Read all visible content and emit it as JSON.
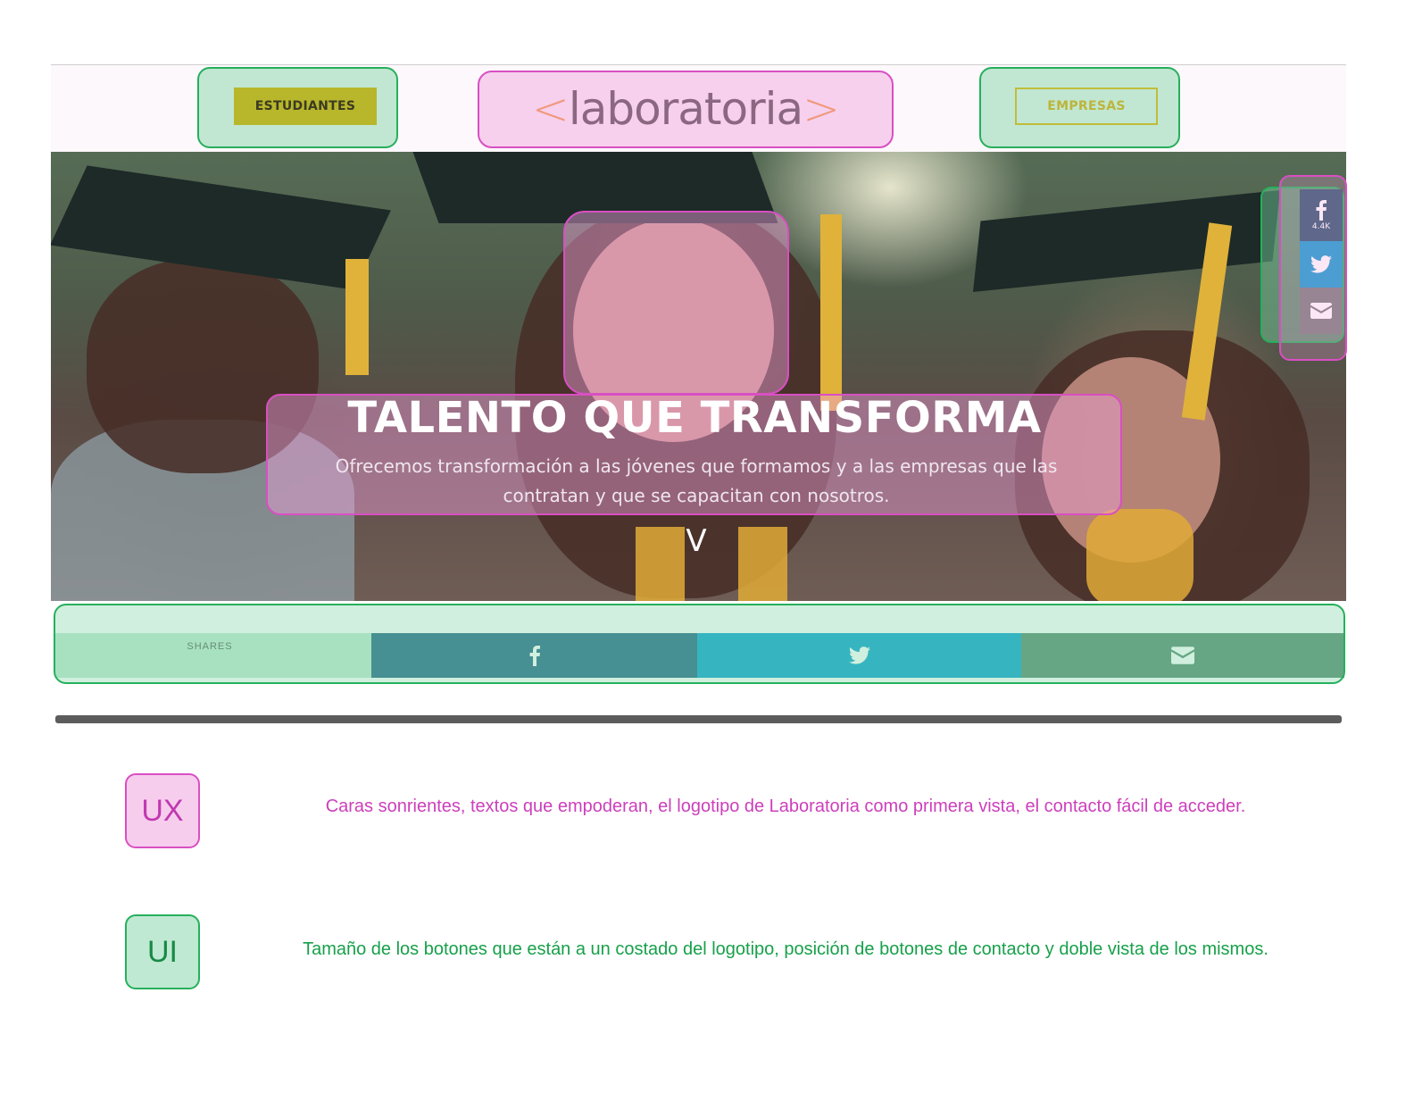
{
  "header": {
    "btn_students": "ESTUDIANTES",
    "logo_left": "<",
    "logo_text": "laboratoria",
    "logo_right": ">",
    "btn_companies": "EMPRESAS"
  },
  "hero": {
    "title": "TALENTO QUE TRANSFORMA",
    "subtitle": "Ofrecemos transformación a las jóvenes que formamos y a las empresas que las contratan y que se capacitan con nosotros.",
    "scroll_glyph": "V"
  },
  "side_share": {
    "facebook_count": "4.4K",
    "icons": [
      "facebook-icon",
      "twitter-icon",
      "mail-icon"
    ]
  },
  "share_bar": {
    "label": "SHARES",
    "icons": [
      "facebook-icon",
      "twitter-icon",
      "mail-icon"
    ]
  },
  "legend": {
    "ux_tag": "UX",
    "ux_text": "Caras sonrientes, textos que empoderan, el logotipo de Laboratoria como primera vista, el contacto fácil de acceder.",
    "ui_tag": "UI",
    "ui_text": "Tamaño de los botones que están a un costado del logotipo, posición de botones de contacto y doble vista de los mismos."
  },
  "colors": {
    "annotation_green": "#26b05c",
    "annotation_pink": "#d94fc3",
    "brand_yellow": "#b8b62a",
    "logo_orange": "#f0922f",
    "facebook": "#2c6c8a",
    "twitter": "#13a6d1",
    "mail": "#5d8f75"
  }
}
